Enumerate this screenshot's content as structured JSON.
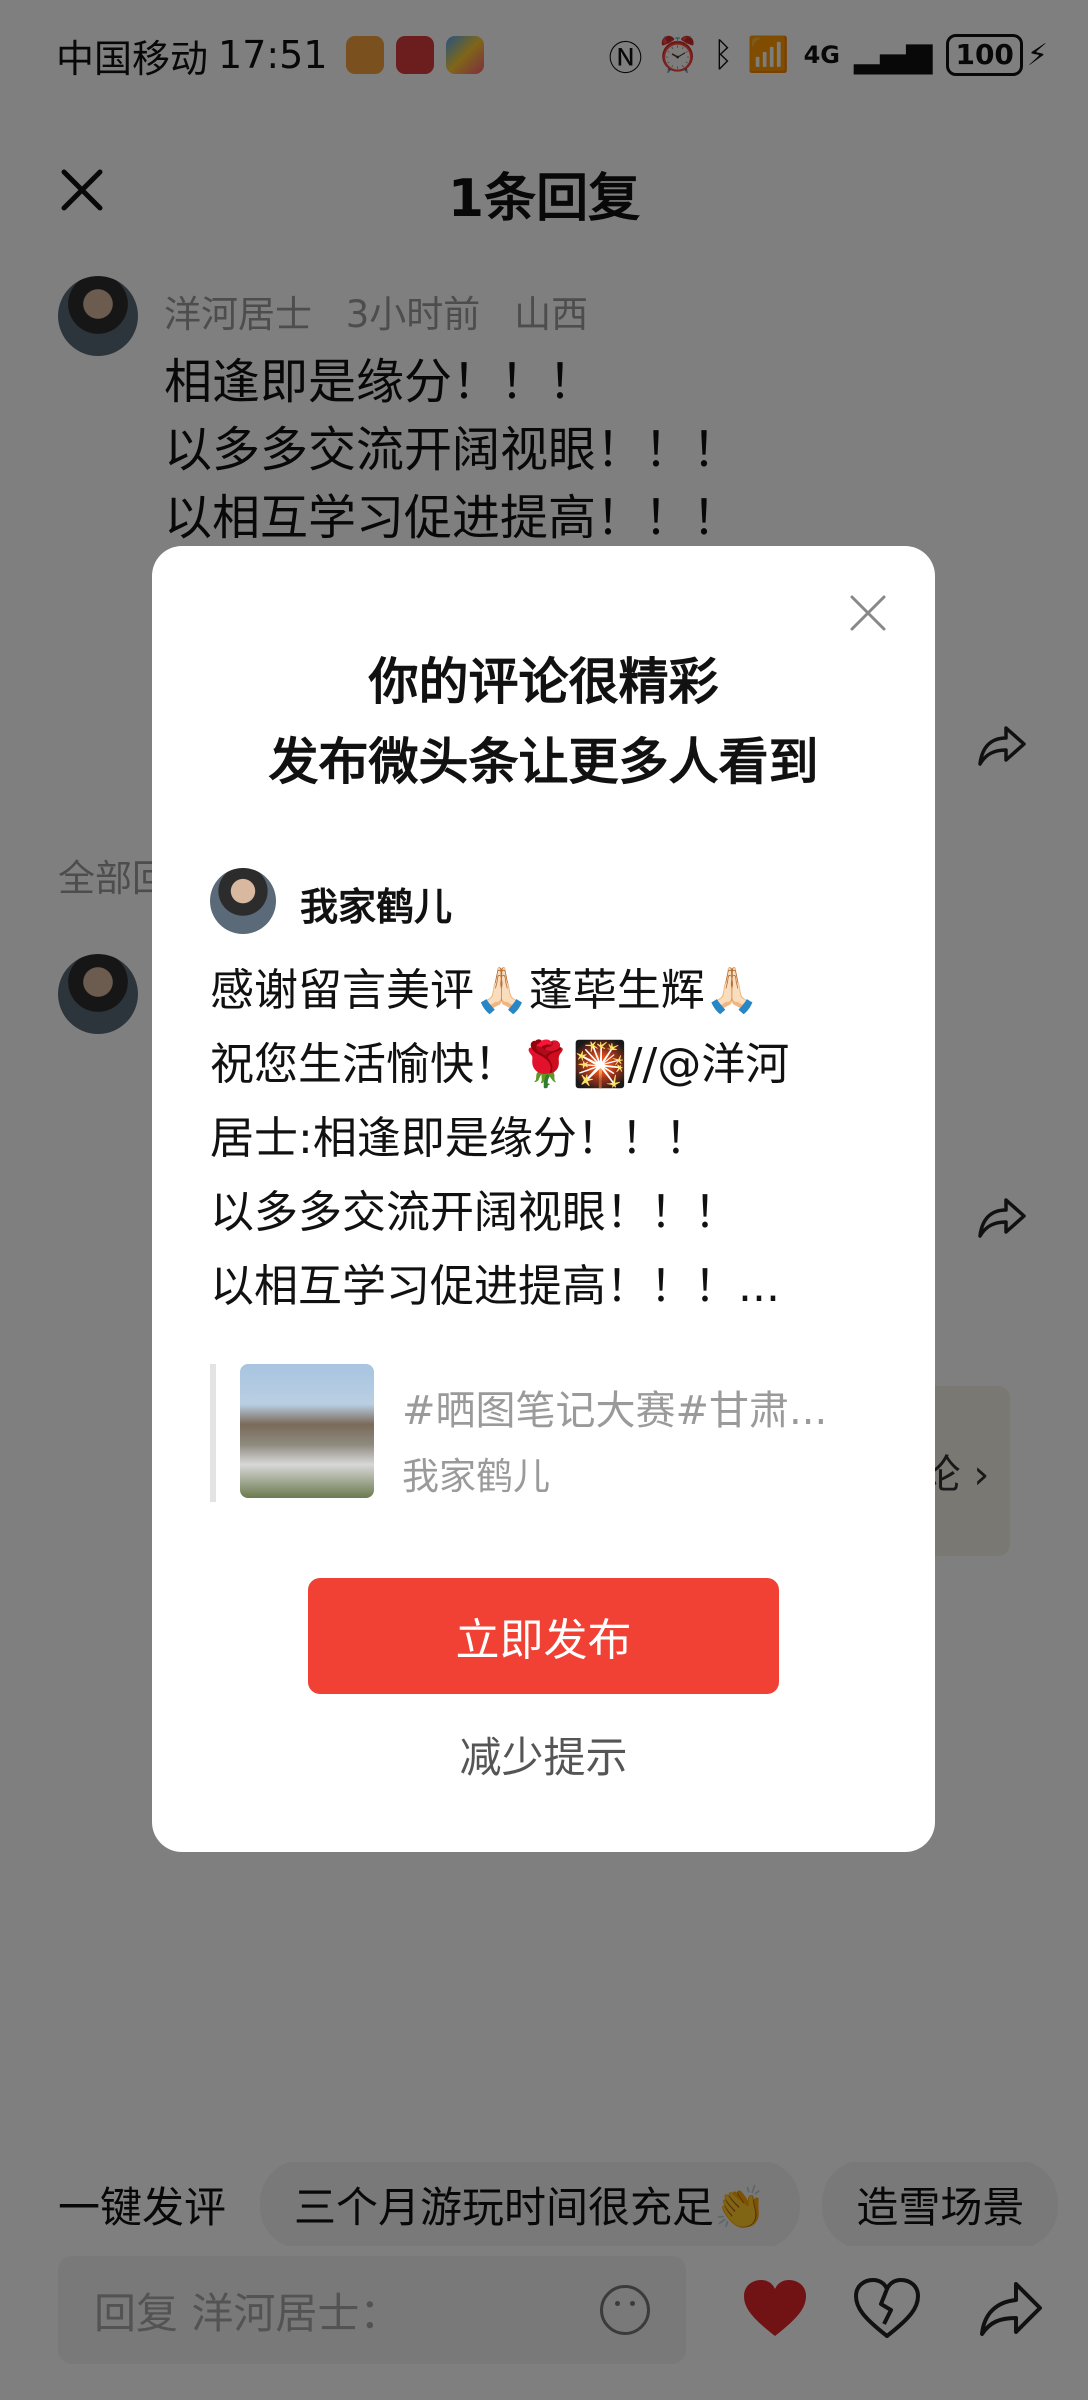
{
  "status_bar": {
    "carrier": "中国移动",
    "time": "17:51",
    "network": "4G",
    "battery": "100"
  },
  "sheet": {
    "title": "1条回复",
    "comment": {
      "author": "洋河居士",
      "time_ago": "3小时前",
      "location": "山西",
      "lines": [
        "相逢即是缘分！！！",
        "以多多交流开阔视眼！！！",
        "以相互学习促进提高！！！"
      ]
    },
    "section_label": "全部回",
    "side_pill_text": "论 ›"
  },
  "modal": {
    "title_line1": "你的评论很精彩",
    "title_line2": "发布微头条让更多人看到",
    "author": "我家鹤儿",
    "text_lines": [
      "感谢留言美评🙏🏻蓬荜生辉🙏🏻",
      "祝您生活愉快！🌹🎇//@洋河",
      "居士:相逢即是缘分！！！",
      "以多多交流开阔视眼！！！",
      "以相互学习促进提高！！！..."
    ],
    "quote_title": "#晒图笔记大赛#甘肃...",
    "quote_author": "我家鹤儿",
    "publish_label": "立即发布",
    "reduce_label": "减少提示"
  },
  "bottom": {
    "quick_label": "一键发评",
    "chips": [
      "三个月游玩时间很充足👏",
      "造雪场景"
    ],
    "reply_placeholder": "回复 洋河居士："
  },
  "colors": {
    "accent_red": "#f04134",
    "like_red": "#e3262b"
  }
}
